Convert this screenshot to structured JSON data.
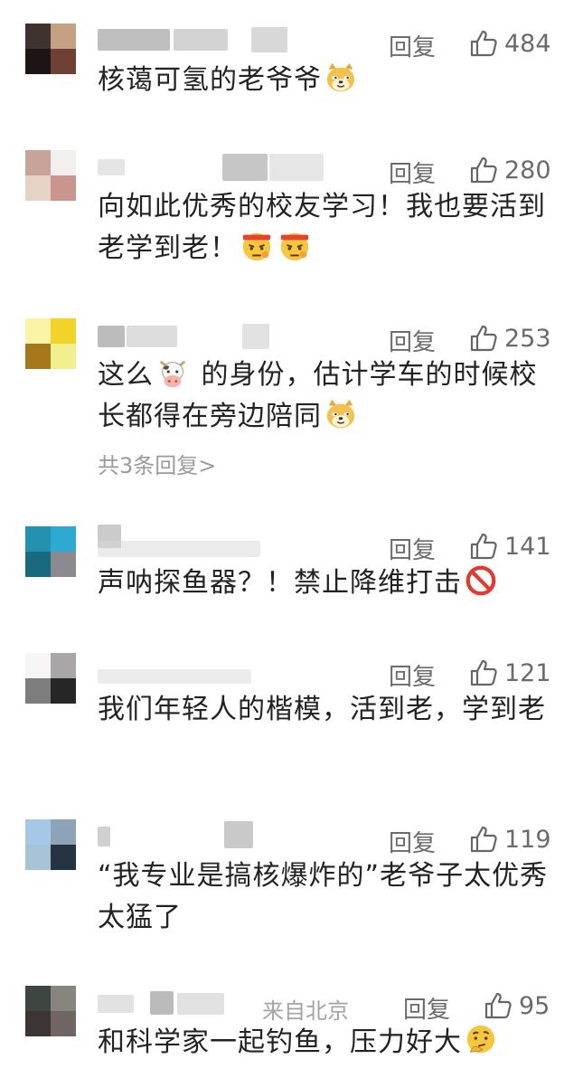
{
  "comments": [
    {
      "avatar_colors": [
        "#3e332f",
        "#c4a183",
        "#1d1414",
        "#6e4134"
      ],
      "reply_label": "回复",
      "like_count": "484",
      "text_before": "核蔼可氢的老爷爷",
      "emoji_a": "doge-icon",
      "text_after": ""
    },
    {
      "avatar_colors": [
        "#c7a39a",
        "#f3efee",
        "#e6d3c8",
        "#c9958e"
      ],
      "reply_label": "回复",
      "like_count": "280",
      "text_before": "向如此优秀的校友学习！我也要活到老学到老！",
      "emoji_a": "determined-face-icon",
      "text_after": ""
    },
    {
      "avatar_colors": [
        "#fbf4a7",
        "#f2d32c",
        "#a5781b",
        "#f1ef8e"
      ],
      "reply_label": "回复",
      "like_count": "253",
      "text_before": "这么",
      "emoji_a": "cow-icon",
      "text_mid": "的身份，估计学车的时候校长都得在旁边陪同",
      "emoji_b": "doge-icon",
      "more_replies": "共3条回复",
      "more_chevron": ">"
    },
    {
      "avatar_colors": [
        "#2391b0",
        "#2ea9d2",
        "#1a6a7f",
        "#8a8a90"
      ],
      "reply_label": "回复",
      "like_count": "141",
      "text_before": "声呐探鱼器？！禁止降维打击",
      "emoji_a": "prohibited-icon",
      "text_after": ""
    },
    {
      "avatar_colors": [
        "#f5f5f5",
        "#a9a6a7",
        "#7d7d7d",
        "#262626"
      ],
      "reply_label": "回复",
      "like_count": "121",
      "text_before": "我们年轻人的楷模，活到老，学到老",
      "text_after": ""
    },
    {
      "avatar_colors": [
        "#a7c7e6",
        "#8da3b8",
        "#a8c2d6",
        "#243443"
      ],
      "reply_label": "回复",
      "like_count": "119",
      "text_before": "“我专业是搞核爆炸的”老爷子太优秀太猛了",
      "text_after": ""
    },
    {
      "avatar_colors": [
        "#3f4540",
        "#86857f",
        "#3b3534",
        "#6f6563"
      ],
      "location": "来自北京",
      "reply_label": "回复",
      "like_count": "95",
      "text_before": "和科学家一起钓鱼，压力好大",
      "emoji_a": "thinking-face-icon",
      "text_after": ""
    }
  ]
}
